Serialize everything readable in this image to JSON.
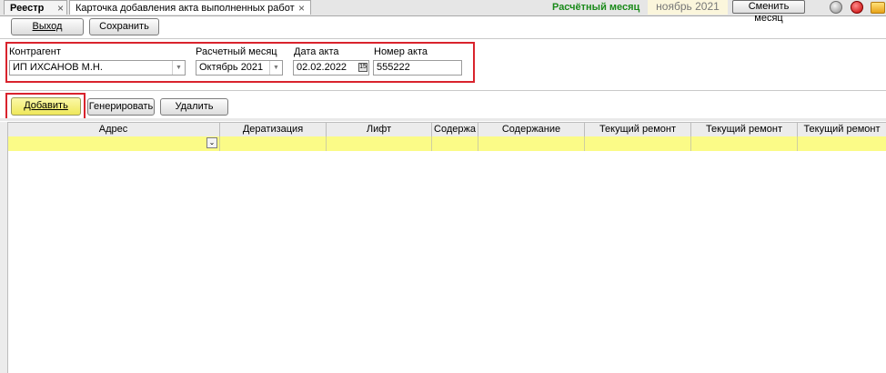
{
  "tabs": [
    {
      "label": "Реестр",
      "close": "×"
    },
    {
      "label": "Карточка добавления акта выполненных работ",
      "close": "×"
    }
  ],
  "header": {
    "month_label": "Расчётный месяц",
    "month_value": "ноябрь 2021",
    "change_month_label": "Сменить месяц",
    "window_controls": [
      "gear-icon",
      "close-icon",
      "mail-icon"
    ]
  },
  "toolbar": {
    "exit_label": "Выход",
    "save_label": "Сохранить"
  },
  "form": {
    "contractor_label": "Контрагент",
    "contractor_value": "ИП ИХСАНОВ М.Н.",
    "month_label": "Расчетный месяц",
    "month_value": "Октябрь 2021",
    "act_date_label": "Дата акта",
    "act_date_value": "02.02.2022",
    "act_number_label": "Номер акта",
    "act_number_value": "555222"
  },
  "actions": {
    "add_label": "Добавить",
    "generate_label": "Генерировать",
    "delete_label": "Удалить"
  },
  "grid": {
    "columns": [
      "Адрес",
      "Дератизация",
      "Лифт",
      "Содержа",
      "Содержание",
      "Текущий ремонт",
      "Текущий ремонт",
      "Текущий ремонт"
    ]
  },
  "colors": {
    "highlight_row": "#fbfb87",
    "add_button": "#f5f07a",
    "annotation_border": "#d9232d",
    "month_label": "#1a8a1a"
  }
}
